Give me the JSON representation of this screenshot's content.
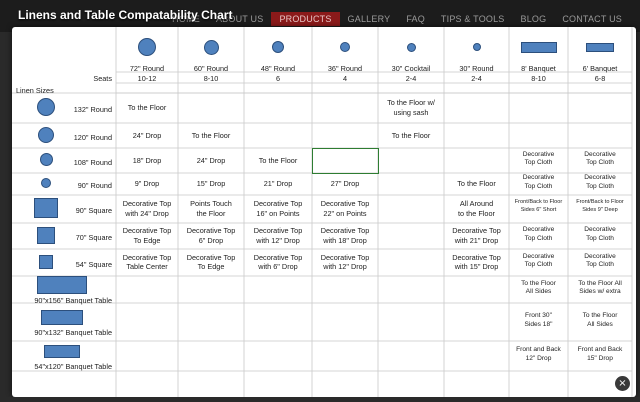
{
  "modal": {
    "title": "Linens and Table Compatability Chart",
    "close_glyph": "×"
  },
  "nav": {
    "items": [
      "HOME",
      "ABOUT US",
      "PRODUCTS",
      "GALLERY",
      "FAQ",
      "TIPS & TOOLS",
      "BLOG",
      "CONTACT US"
    ],
    "active": "PRODUCTS"
  },
  "colors": {
    "shape_fill": "#4f81bd",
    "shape_border": "#2c4f7c",
    "nav_active": "#8b1a1a"
  },
  "table": {
    "seats_label": "Seats",
    "linen_sizes_label": "Linen Sizes",
    "columns": [
      {
        "name": "72\" Round",
        "seats": "10-12",
        "shape": "circle"
      },
      {
        "name": "60\" Round",
        "seats": "8-10",
        "shape": "circle"
      },
      {
        "name": "48\" Round",
        "seats": "6",
        "shape": "circle"
      },
      {
        "name": "36\" Round",
        "seats": "4",
        "shape": "circle"
      },
      {
        "name": "30\" Cocktail",
        "seats": "2-4",
        "shape": "circle"
      },
      {
        "name": "30\" Round",
        "seats": "2-4",
        "shape": "circle"
      },
      {
        "name": "8' Banquet",
        "seats": "8-10",
        "shape": "rect"
      },
      {
        "name": "6' Banquet",
        "seats": "6-8",
        "shape": "rect"
      }
    ],
    "rows": [
      {
        "label": "132\" Round",
        "shape": "circle",
        "cells": [
          "To the Floor",
          "",
          "",
          "",
          "To the Floor w/\nusing sash",
          "",
          "",
          ""
        ]
      },
      {
        "label": "120\" Round",
        "shape": "circle",
        "cells": [
          "24\" Drop",
          "To the Floor",
          "",
          "",
          "To the Floor",
          "",
          "",
          ""
        ]
      },
      {
        "label": "108\" Round",
        "shape": "circle",
        "cells": [
          "18\" Drop",
          "24\" Drop",
          "To the Floor",
          "",
          "",
          "",
          "Decorative\nTop Cloth",
          "Decorative\nTop Cloth"
        ]
      },
      {
        "label": "90\" Round",
        "shape": "circle",
        "cells": [
          "9\" Drop",
          "15\" Drop",
          "21\" Drop",
          "27\" Drop",
          "",
          "To the Floor",
          "Decorative\nTop Cloth",
          "Decorative\nTop Cloth"
        ]
      },
      {
        "label": "90\" Square",
        "shape": "square",
        "cells": [
          "Decorative Top\nwith 24\" Drop",
          "Points Touch\nthe Floor",
          "Decorative Top\n16\" on Points",
          "Decorative Top\n22\" on Points",
          "",
          "All Around\nto the Floor",
          "Front/Back to Floor\nSides 6\" Short",
          "Front/Back to Floor\nSides 9\" Deep"
        ]
      },
      {
        "label": "70\" Square",
        "shape": "square",
        "cells": [
          "Decorative Top\nTo Edge",
          "Decorative Top\n6\" Drop",
          "Decorative Top\nwith 12\" Drop",
          "Decorative Top\nwith 18\" Drop",
          "",
          "Decorative Top\nwith 21\" Drop",
          "Decorative\nTop Cloth",
          "Decorative\nTop Cloth"
        ]
      },
      {
        "label": "54\" Square",
        "shape": "square",
        "cells": [
          "Decorative Top\nTable Center",
          "Decorative Top\nTo Edge",
          "Decorative Top\nwith 6\" Drop",
          "Decorative Top\nwith 12\" Drop",
          "",
          "Decorative Top\nwith 15\" Drop",
          "Decorative\nTop Cloth",
          "Decorative\nTop Cloth"
        ]
      },
      {
        "label": "90\"x156\" Banquet Table",
        "shape": "rect",
        "cells": [
          "",
          "",
          "",
          "",
          "",
          "",
          "To the Floor\nAll Sides",
          "To the Floor All\nSides w/ extra"
        ]
      },
      {
        "label": "90\"x132\" Banquet Table",
        "shape": "rect",
        "cells": [
          "",
          "",
          "",
          "",
          "",
          "",
          "Front 30\"\nSides 18\"",
          "To the Floor\nAll Sides"
        ]
      },
      {
        "label": "54\"x120\" Banquet Table",
        "shape": "rect",
        "cells": [
          "",
          "",
          "",
          "",
          "",
          "",
          "Front and Back\n12\" Drop",
          "Front and Back\n15\" Drop"
        ]
      }
    ]
  }
}
